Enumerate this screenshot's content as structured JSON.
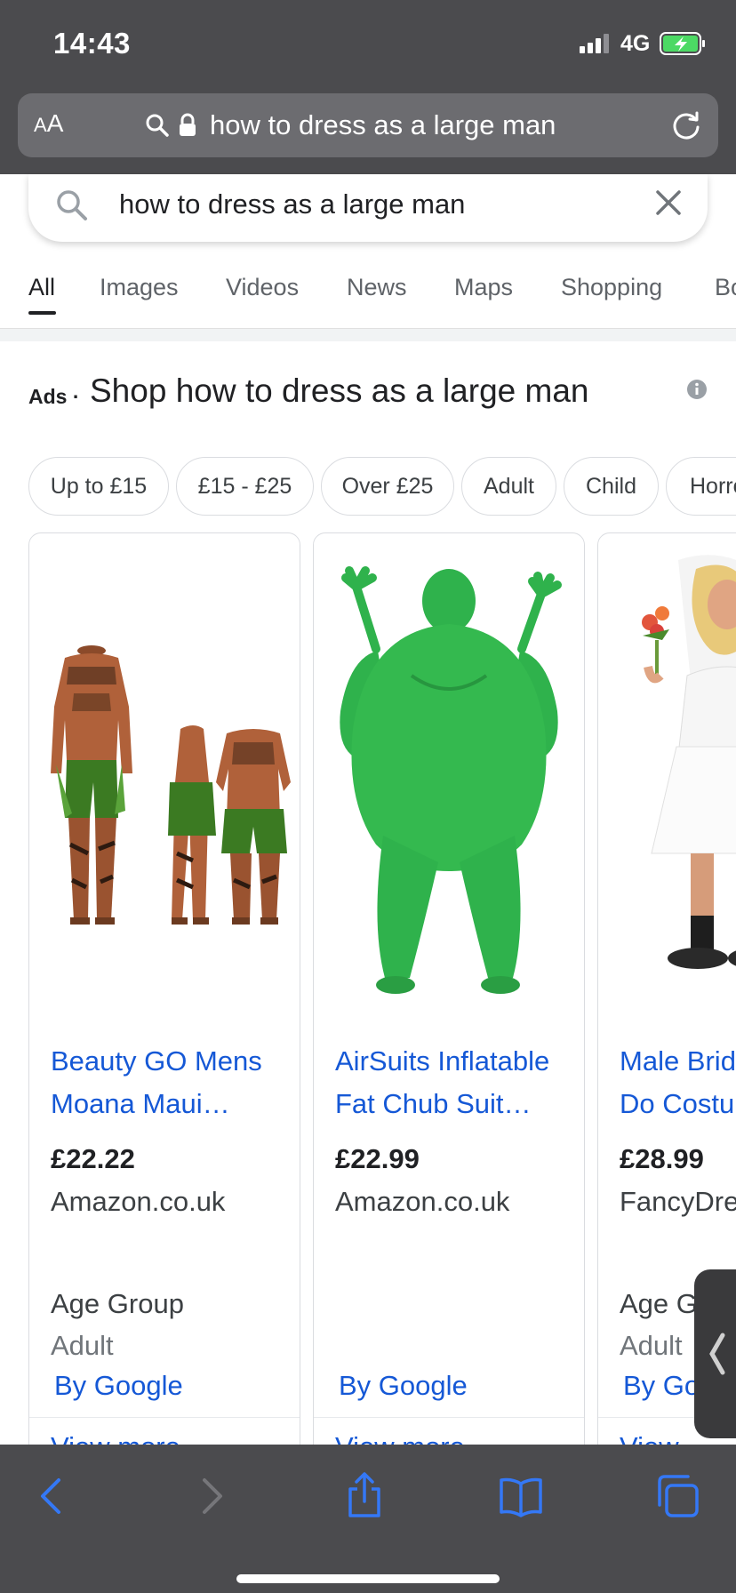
{
  "status_bar": {
    "time": "14:43",
    "network": "4G"
  },
  "address_bar": {
    "aa_small": "A",
    "aa_large": "A",
    "url": "how to dress as a large man"
  },
  "search": {
    "query": "how to dress as a large man"
  },
  "tabs": [
    {
      "label": "All",
      "active": true
    },
    {
      "label": "Images"
    },
    {
      "label": "Videos"
    },
    {
      "label": "News"
    },
    {
      "label": "Maps"
    },
    {
      "label": "Shopping"
    },
    {
      "label": "Bo"
    }
  ],
  "ads": {
    "label": "Ads",
    "separator": "·",
    "title": "Shop how to dress as a large man"
  },
  "filters": [
    "Up to £15",
    "£15 - £25",
    "Over £25",
    "Adult",
    "Child",
    "Horro"
  ],
  "products": [
    {
      "title_line1": "Beauty GO Mens",
      "title_line2": "Moana Maui…",
      "price": "£22.22",
      "merchant": "Amazon.co.uk",
      "attr_name": "Age Group",
      "attr_value": "Adult",
      "by_google": "By Google",
      "view_more": "View more"
    },
    {
      "title_line1": "AirSuits Inflatable",
      "title_line2": "Fat Chub Suit…",
      "price": "£22.99",
      "merchant": "Amazon.co.uk",
      "attr_name": "",
      "attr_value": "",
      "by_google": "By Google",
      "view_more": "View more"
    },
    {
      "title_line1": "Male Brid",
      "title_line2": "Do Costu",
      "price": "£28.99",
      "merchant": "FancyDre",
      "attr_name": "Age G",
      "attr_value": "Adult",
      "by_google": "By Go",
      "view_more": "View"
    }
  ],
  "colors": {
    "safari_chrome": "#4b4b4e",
    "link_blue": "#1558d6",
    "ios_blue": "#3478f6",
    "battery_green": "#4cd964",
    "costume_green": "#2fb24c"
  },
  "icons": [
    "search-icon",
    "lock-icon",
    "reload-icon",
    "clear-icon",
    "info-icon",
    "back-icon",
    "forward-icon",
    "share-icon",
    "bookmarks-icon",
    "tabs-icon"
  ]
}
